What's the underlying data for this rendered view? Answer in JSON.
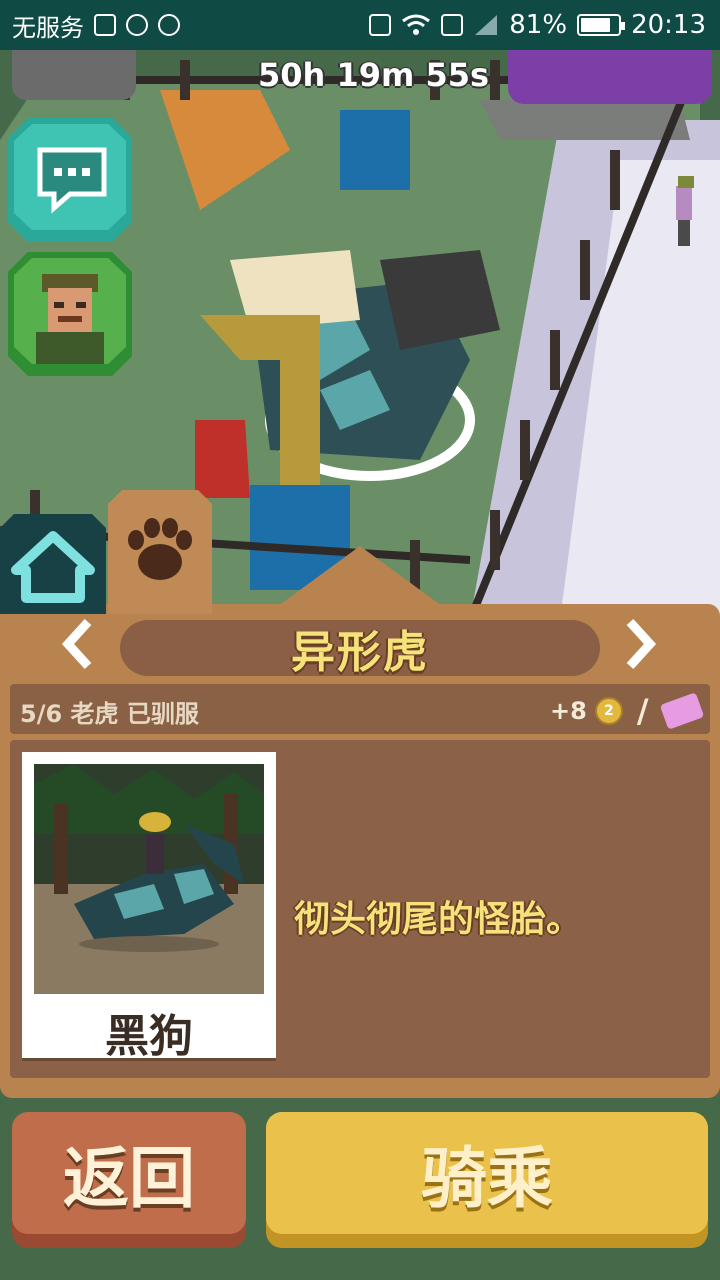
{
  "status_bar": {
    "carrier": "无服务",
    "battery": "81%",
    "battery_level": 0.81,
    "time": "20:13"
  },
  "timer": "50h 19m 55s",
  "nav_tabs": [
    {
      "icon": "home-icon"
    },
    {
      "icon": "paw-icon",
      "active": true
    }
  ],
  "animal_panel": {
    "title": "异形虎",
    "progress_text": "5/6 老虎 已驯服",
    "reward": "+8",
    "reward_coin": "2",
    "separator": "/",
    "photo_caption": "黑狗",
    "description": "彻头彻尾的怪胎。"
  },
  "buttons": {
    "back": "返回",
    "ride": "骑乘"
  },
  "colors": {
    "panel": "#b9834f",
    "title_text": "#f5e27a",
    "back_button": "#c06d4c",
    "ride_button": "#eac24b"
  }
}
